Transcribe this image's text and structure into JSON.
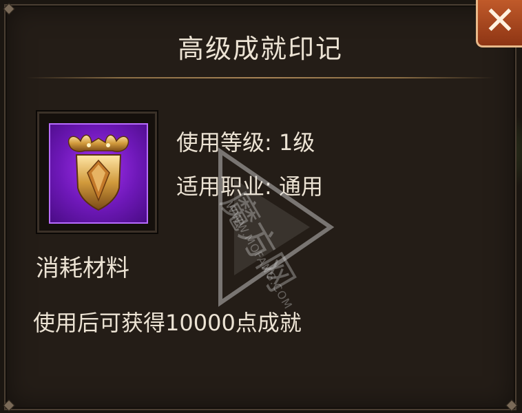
{
  "dialog": {
    "title": "高级成就印记",
    "close_icon": "close-x-icon"
  },
  "item": {
    "icon": "golden-winged-shield-icon",
    "rarity_color": "#8a22dc",
    "use_level": "使用等级: 1级",
    "applicable_class": "适用职业: 通用",
    "type": "消耗材料",
    "description": "使用后可获得10000点成就"
  },
  "watermark": {
    "brand": "魔方网",
    "url": "WWW.MOFANG.COM"
  }
}
